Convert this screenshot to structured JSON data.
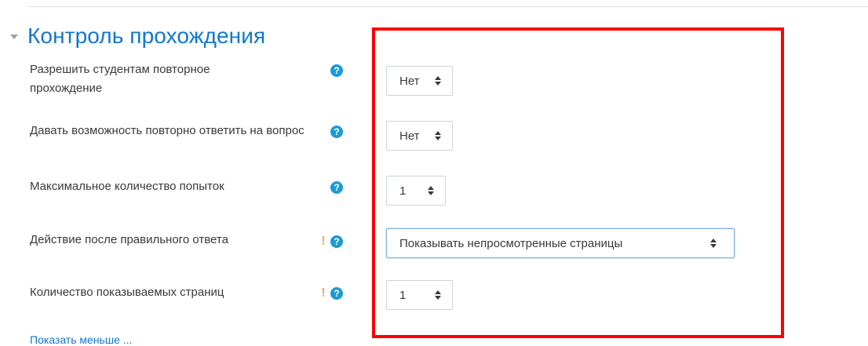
{
  "section": {
    "title": "Контроль прохождения"
  },
  "fields": [
    {
      "label": "Разрешить студентам повторное прохождение",
      "help": "?",
      "value": "Нет"
    },
    {
      "label": "Давать возможность повторно ответить на вопрос",
      "help": "?",
      "value": "Нет"
    },
    {
      "label": "Максимальное количество попыток",
      "help": "?",
      "value": "1"
    },
    {
      "label": "Действие после правильного ответа",
      "advanced_mark": "!",
      "help": "?",
      "value": "Показывать непросмотренные страницы"
    },
    {
      "label": "Количество показываемых страниц",
      "advanced_mark": "!",
      "help": "?",
      "value": "1"
    }
  ],
  "footer": {
    "show_less_link": "Показать меньше ..."
  },
  "colors": {
    "link_blue": "#1177d1",
    "help_icon": "#1b9bd4",
    "advanced_mark": "#f0ad4e",
    "annotation_box": "#ff0000"
  },
  "icons": {
    "section_toggle": "caret-down-icon",
    "help": "question-circle-icon",
    "advanced": "exclamation-icon",
    "select_arrows": "sort-arrows-icon"
  }
}
